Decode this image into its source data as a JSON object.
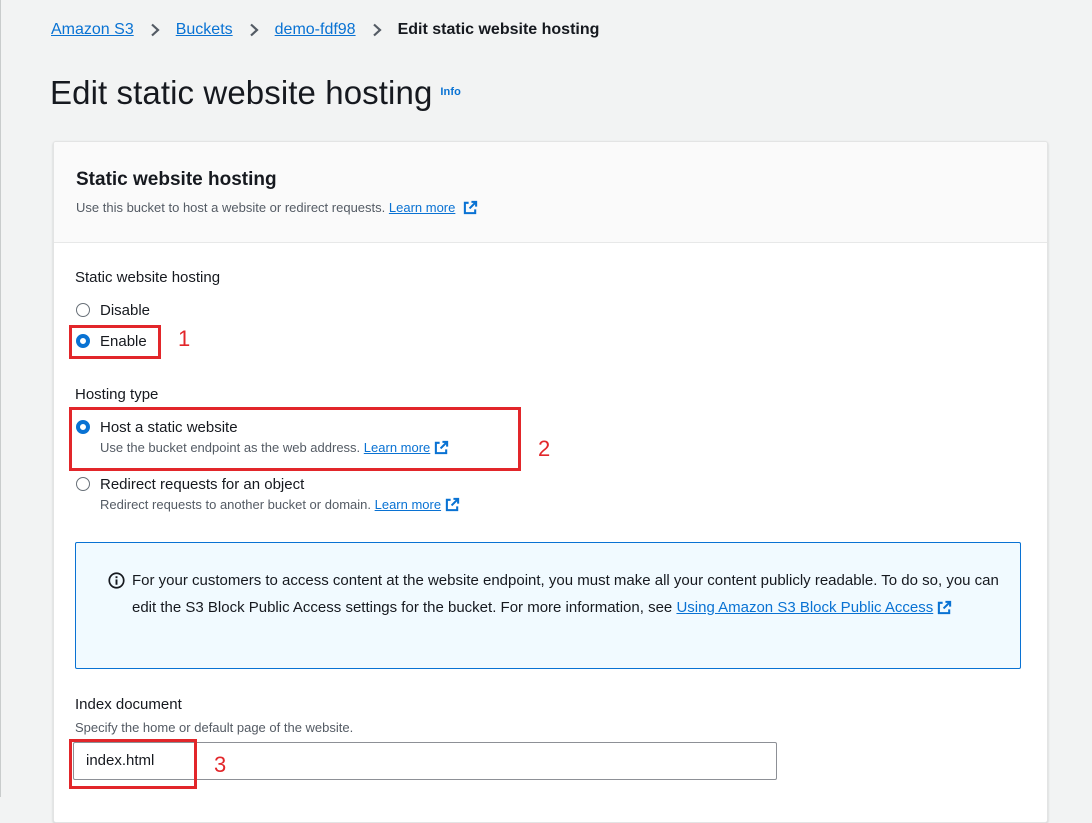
{
  "breadcrumb": {
    "items": [
      "Amazon S3",
      "Buckets",
      "demo-fdf98"
    ],
    "current": "Edit static website hosting"
  },
  "page": {
    "title": "Edit static website hosting",
    "info_link": "Info"
  },
  "panel": {
    "title": "Static website hosting",
    "description": "Use this bucket to host a website or redirect requests.",
    "learn_more": "Learn more"
  },
  "hosting": {
    "label": "Static website hosting",
    "options": [
      "Disable",
      "Enable"
    ],
    "selected": "Enable"
  },
  "hosting_type": {
    "label": "Hosting type",
    "options": [
      {
        "label": "Host a static website",
        "description": "Use the bucket endpoint as the web address.",
        "link": "Learn more",
        "selected": true
      },
      {
        "label": "Redirect requests for an object",
        "description": "Redirect requests to another bucket or domain.",
        "link": "Learn more",
        "selected": false
      }
    ]
  },
  "alert": {
    "text": "For your customers to access content at the website endpoint, you must make all your content publicly readable. To do so, you can edit the S3 Block Public Access settings for the bucket. For more information, see",
    "link": "Using Amazon S3 Block Public Access"
  },
  "index_document": {
    "label": "Index document",
    "description": "Specify the home or default page of the website.",
    "value": "index.html"
  },
  "annotations": [
    "1",
    "2",
    "3"
  ],
  "colors": {
    "link": "#0972d3",
    "annotation": "#e2262a",
    "alert_bg": "#f1faff",
    "page_bg": "#f2f3f3"
  }
}
